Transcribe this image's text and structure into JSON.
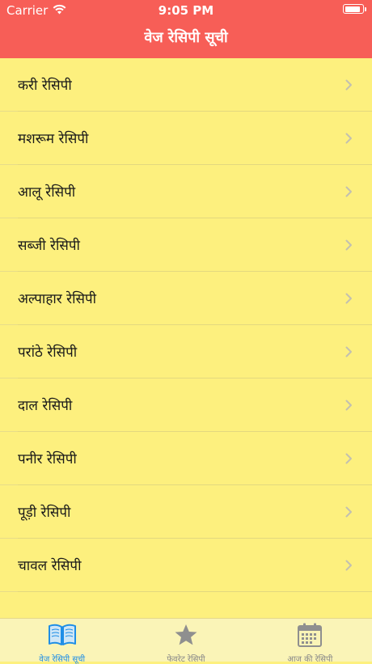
{
  "status_bar": {
    "carrier": "Carrier",
    "time": "9:05 PM"
  },
  "nav": {
    "title": "वेज रेसिपी सूची"
  },
  "list": {
    "items": [
      {
        "label": "करी रेसिपी"
      },
      {
        "label": "मशरूम रेसिपी"
      },
      {
        "label": "आलू रेसिपी"
      },
      {
        "label": "सब्जी रेसिपी"
      },
      {
        "label": "अल्पाहार रेसिपी"
      },
      {
        "label": "परांठे रेसिपी"
      },
      {
        "label": "दाल रेसिपी"
      },
      {
        "label": "पनीर रेसिपी"
      },
      {
        "label": "पूड़ी रेसिपी"
      },
      {
        "label": "चावल रेसिपी"
      }
    ]
  },
  "tabbar": {
    "tabs": [
      {
        "label": "वेज रेसिपी सूची",
        "icon": "book-icon",
        "active": true
      },
      {
        "label": "फेवरेट रेसिपी",
        "icon": "star-icon",
        "active": false
      },
      {
        "label": "आज की रेसिपी",
        "icon": "calendar-icon",
        "active": false
      }
    ]
  },
  "colors": {
    "header": "#f75e57",
    "background": "#fdf07e",
    "tab_active": "#1f8ee6",
    "tab_inactive": "#888888"
  }
}
